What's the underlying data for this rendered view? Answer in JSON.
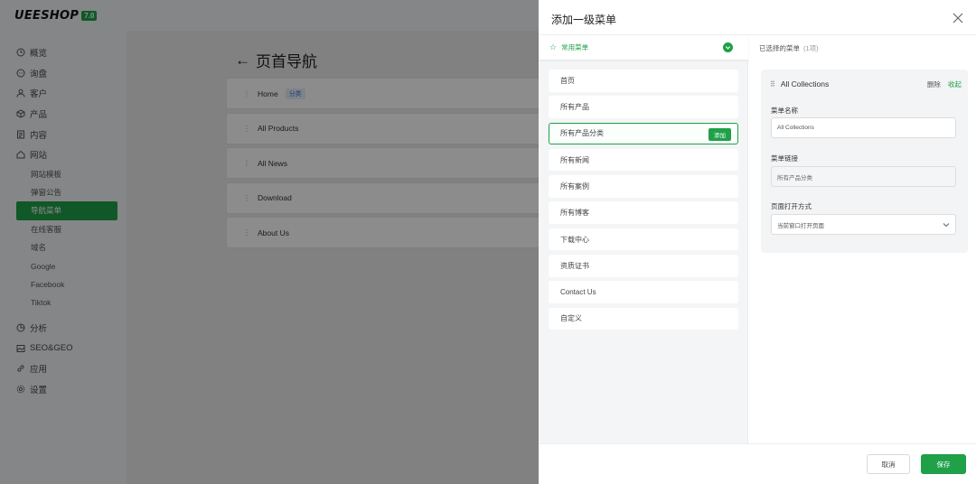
{
  "app": {
    "logo_text": "UEESHOP",
    "logo_version": "7.0",
    "nav": [
      {
        "label": "概览",
        "icon": "clock-icon"
      },
      {
        "label": "询盘",
        "icon": "chat-icon"
      },
      {
        "label": "客户",
        "icon": "user-icon"
      },
      {
        "label": "产品",
        "icon": "cube-icon"
      },
      {
        "label": "内容",
        "icon": "document-icon"
      },
      {
        "label": "网站",
        "icon": "home-icon"
      }
    ],
    "subnav": [
      {
        "label": "网站模板"
      },
      {
        "label": "弹窗公告"
      },
      {
        "label": "导航菜单"
      },
      {
        "label": "在线客服"
      },
      {
        "label": "域名"
      },
      {
        "label": "Google"
      },
      {
        "label": "Facebook"
      },
      {
        "label": "Tiktok"
      }
    ],
    "nav_bottom": [
      {
        "label": "分析",
        "icon": "chart-icon"
      },
      {
        "label": "SEO&GEO",
        "icon": "image-icon"
      },
      {
        "label": "应用",
        "icon": "link-icon"
      },
      {
        "label": "设置",
        "icon": "gear-icon"
      }
    ],
    "page_title": "页首导航",
    "menu_rows": [
      {
        "label": "Home",
        "tag": "分类"
      },
      {
        "label": "All Products",
        "tag": ""
      },
      {
        "label": "All News",
        "tag": ""
      },
      {
        "label": "Download",
        "tag": ""
      },
      {
        "label": "About Us",
        "tag": ""
      }
    ]
  },
  "drawer": {
    "title": "添加一级菜单",
    "favorites_label": "常用菜单",
    "options": [
      {
        "label": "首页"
      },
      {
        "label": "所有产品"
      },
      {
        "label": "所有产品分类",
        "active": true
      },
      {
        "label": "所有新闻"
      },
      {
        "label": "所有案例"
      },
      {
        "label": "所有博客"
      },
      {
        "label": "下载中心"
      },
      {
        "label": "资质证书"
      },
      {
        "label": "Contact Us"
      },
      {
        "label": "自定义"
      }
    ],
    "add_label": "添加",
    "selected_title": "已选择的菜单",
    "selected_count": "(1项)",
    "card": {
      "title": "All Collections",
      "delete_label": "删除",
      "fold_label": "收起",
      "name_label": "菜单名称",
      "name_value": "All Collections",
      "link_label": "菜单链接",
      "link_value": "所有产品分类",
      "open_label": "页面打开方式",
      "open_value": "当前窗口打开页面"
    },
    "cancel_label": "取消",
    "save_label": "保存"
  },
  "colors": {
    "accent": "#1fa049",
    "tag_blue": "#3b73d8"
  }
}
